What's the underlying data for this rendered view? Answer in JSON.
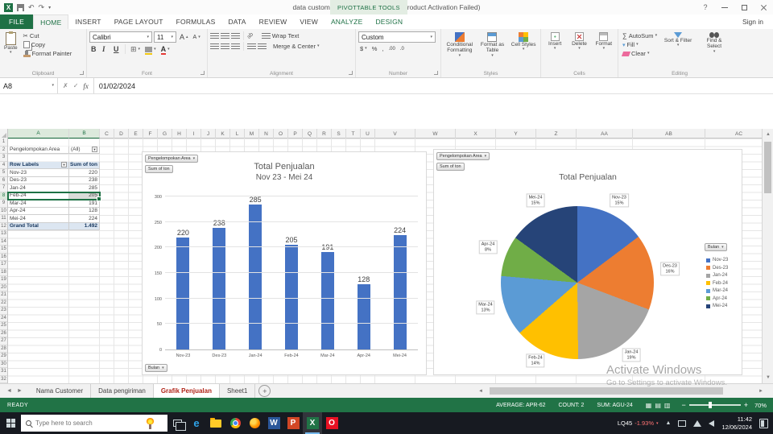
{
  "titlebar": {
    "title": "data customer Jateng 2024 - Excel (Product Activation Failed)",
    "context_group": "PIVOTTABLE TOOLS",
    "help": "?"
  },
  "tabs": {
    "file_label": "FILE",
    "items": [
      "HOME",
      "INSERT",
      "PAGE LAYOUT",
      "FORMULAS",
      "DATA",
      "REVIEW",
      "VIEW"
    ],
    "active": "HOME",
    "contextual": [
      "ANALYZE",
      "DESIGN"
    ],
    "sign_in": "Sign in"
  },
  "ribbon": {
    "clipboard": {
      "group_label": "Clipboard",
      "paste_label": "Paste",
      "cut_label": "Cut",
      "copy_label": "Copy",
      "format_painter_label": "Format Painter"
    },
    "font": {
      "group_label": "Font",
      "font_name": "Calibri",
      "font_size": "11",
      "bold": "B",
      "italic": "I",
      "underline": "U",
      "grow_letter": "A",
      "shrink_letter": "A",
      "font_color_letter": "A"
    },
    "alignment": {
      "group_label": "Alignment",
      "wrap_label": "Wrap Text",
      "merge_label": "Merge & Center"
    },
    "number": {
      "group_label": "Number",
      "format_value": "Custom",
      "currency": "$",
      "percent": "%",
      "comma": ",",
      "increase_decimal": ".00",
      "decrease_decimal": ".0"
    },
    "styles": {
      "group_label": "Styles",
      "conditional_label": "Conditional Formatting",
      "format_table_label": "Format as Table",
      "cell_styles_label": "Cell Styles"
    },
    "cells": {
      "group_label": "Cells",
      "insert_label": "Insert",
      "delete_label": "Delete",
      "format_label": "Format"
    },
    "editing": {
      "group_label": "Editing",
      "autosum_symbol": "∑",
      "autosum_label": "AutoSum",
      "fill_label": "Fill",
      "clear_label": "Clear",
      "sort_label": "Sort & Filter",
      "find_label": "Find & Select"
    }
  },
  "formula_bar": {
    "name_box": "A8",
    "cancel": "✗",
    "enter": "✓",
    "fx": "fx",
    "value": "01/02/2024"
  },
  "grid": {
    "columns": [
      "A",
      "B",
      "C",
      "D",
      "E",
      "F",
      "G",
      "H",
      "I",
      "J",
      "K",
      "L",
      "M",
      "N",
      "O",
      "P",
      "Q",
      "R",
      "S",
      "T",
      "U",
      "V",
      "W",
      "X",
      "Y",
      "Z",
      "AA",
      "AB",
      "AC"
    ],
    "row_count": 32,
    "selected_columns": [
      "A",
      "B"
    ],
    "selected_row": 8
  },
  "pivot": {
    "filter_label": "Pengelompokan Area",
    "filter_value": "(All)",
    "columns": [
      "Row Labels",
      "Sum of ton"
    ],
    "rows": [
      [
        "Nov-23",
        "220"
      ],
      [
        "Des-23",
        "238"
      ],
      [
        "Jan-24",
        "285"
      ],
      [
        "Feb-24",
        "205"
      ],
      [
        "Mar-24",
        "191"
      ],
      [
        "Apr-24",
        "128"
      ],
      [
        "Mei-24",
        "224"
      ]
    ],
    "grand_total": [
      "Grand Total",
      "1.492"
    ],
    "selected_row_index": 3
  },
  "chart_data": [
    {
      "type": "bar",
      "title": "Total Penjualan",
      "subtitle": "Nov 23 - Mei 24",
      "categories": [
        "Nov-23",
        "Des-23",
        "Jan-24",
        "Feb-24",
        "Mar-24",
        "Apr-24",
        "Mei-24"
      ],
      "values": [
        220,
        238,
        285,
        205,
        191,
        128,
        224
      ],
      "ylim": [
        0,
        300
      ],
      "yticks": [
        0,
        50,
        100,
        150,
        200,
        250,
        300
      ],
      "grid": true,
      "legend": "none",
      "bar_color": "#4472C4",
      "field_buttons": {
        "filter": "Pengelompokan Area",
        "value": "Sum of ton",
        "axis": "Bulan"
      }
    },
    {
      "type": "pie",
      "title": "Total Penjualan",
      "categories": [
        "Nov-23",
        "Des-23",
        "Jan-24",
        "Feb-24",
        "Mar-24",
        "Apr-24",
        "Mei-24"
      ],
      "values": [
        220,
        238,
        285,
        205,
        191,
        128,
        224
      ],
      "percent_labels": [
        "15%",
        "16%",
        "19%",
        "14%",
        "13%",
        "8%",
        "15%"
      ],
      "colors": [
        "#4472C4",
        "#ED7D31",
        "#A5A5A5",
        "#FFC000",
        "#5B9BD5",
        "#70AD47",
        "#264478"
      ],
      "legend_title": "Bulan",
      "legend_position": "right",
      "field_buttons": {
        "filter": "Pengelompokan Area",
        "value": "Sum of ton"
      }
    }
  ],
  "sheet_bar": {
    "tabs": [
      "Nama Customer",
      "Data pengiriman",
      "Grafik Penjualan",
      "Sheet1"
    ],
    "active": "Grafik Penjualan",
    "add_label": "+"
  },
  "status_bar": {
    "mode": "READY",
    "stats": [
      "AVERAGE: APR-62",
      "COUNT: 2",
      "SUM: AGU-24"
    ],
    "zoom_out": "−",
    "zoom_in": "+",
    "zoom": "70%"
  },
  "taskbar": {
    "search_placeholder": "Type here to search",
    "icons": [
      {
        "name": "edge-icon",
        "glyph": "e",
        "color": "#2FA3E8",
        "bg": "none"
      },
      {
        "name": "file-explorer-icon",
        "glyph": "",
        "color": "",
        "bg": "folder"
      },
      {
        "name": "chrome-icon",
        "glyph": "",
        "color": "",
        "bg": "chrome"
      },
      {
        "name": "firefox-icon",
        "glyph": "",
        "color": "",
        "bg": "firefox"
      },
      {
        "name": "word-icon",
        "glyph": "W",
        "color": "#fff",
        "bg": "#2B579A"
      },
      {
        "name": "powerpoint-icon",
        "glyph": "P",
        "color": "#fff",
        "bg": "#D24726"
      },
      {
        "name": "excel-icon",
        "glyph": "X",
        "color": "#fff",
        "bg": "#217346",
        "active": true
      },
      {
        "name": "browser-red-icon",
        "glyph": "O",
        "color": "#fff",
        "bg": "#E81123"
      }
    ],
    "ticker_label": "LQ45",
    "ticker_change": "-1.93%",
    "time": "11:42",
    "date": "12/06/2024"
  },
  "watermark": {
    "line1": "Activate Windows",
    "line2": "Go to Settings to activate Windows."
  }
}
